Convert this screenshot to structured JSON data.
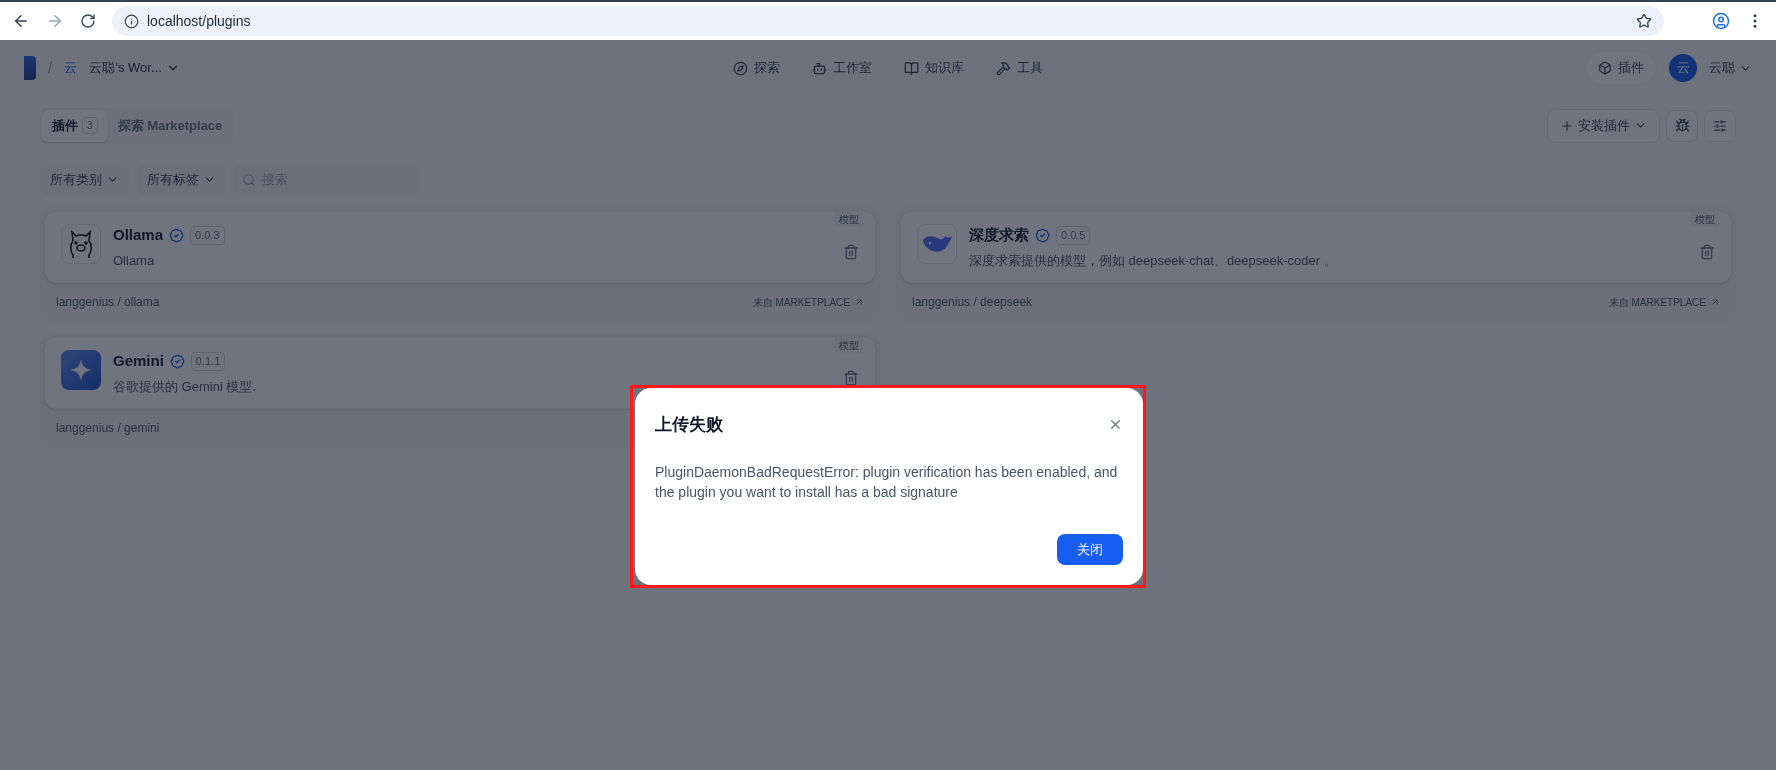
{
  "browser": {
    "url": "localhost/plugins"
  },
  "header": {
    "separator": "/",
    "workspace_initial": "云",
    "workspace_name": "云聪's Wor...",
    "nav": [
      {
        "kind": "explore",
        "label": "探索"
      },
      {
        "kind": "studio",
        "label": "工作室"
      },
      {
        "kind": "knowledge",
        "label": "知识库"
      },
      {
        "kind": "tools",
        "label": "工具"
      }
    ],
    "plugins_button": "插件",
    "user": {
      "initial": "云",
      "name": "云聪"
    }
  },
  "tabs": [
    {
      "label": "插件",
      "count": "3",
      "selected": true
    },
    {
      "label": "探索 Marketplace",
      "selected": false
    }
  ],
  "install_button": "安装插件",
  "filters": {
    "category": "所有类别",
    "tags": "所有标签",
    "search": {
      "placeholder": "搜索"
    }
  },
  "plugins": [
    {
      "kind": "llama",
      "name": "Ollama",
      "version": "0.0.3",
      "description": "Ollama",
      "tag": "模型",
      "author_path": "langgenius / ollama",
      "source": "来自 MARKETPLACE"
    },
    {
      "kind": "whale",
      "name": "深度求索",
      "version": "0.0.5",
      "description": "深度求索提供的模型，例如 deepseek-chat、deepseek-coder 。",
      "tag": "模型",
      "author_path": "langgenius / deepseek",
      "source": "来自 MARKETPLACE"
    },
    {
      "kind": "sparkle",
      "name": "Gemini",
      "version": "0.1.1",
      "description": "谷歌提供的 Gemini 模型.",
      "tag": "模型",
      "author_path": "langgenius / gemini"
    }
  ],
  "dialog": {
    "title": "上传失败",
    "message": "PluginDaemonBadRequestError: plugin verification has been enabled, and the plugin you want to install has a bad signature",
    "button": "关闭"
  }
}
